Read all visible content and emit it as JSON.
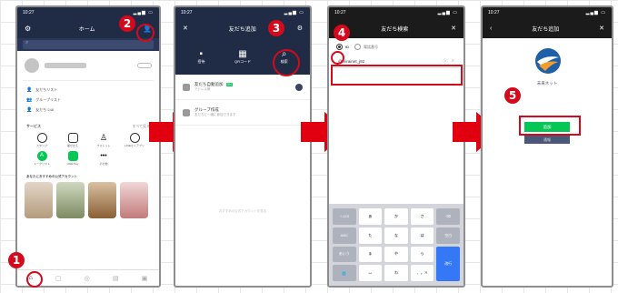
{
  "steps": [
    "1",
    "2",
    "3",
    "4",
    "5"
  ],
  "phone1": {
    "status_time": "10:27",
    "header_title": "ホーム",
    "menu": [
      "友だちリスト",
      "グループリスト",
      "友だち 248"
    ],
    "services_label": "サービス",
    "services_more": "すべて見る",
    "service_icons": [
      "スタンプ",
      "着せかえ",
      "ウォレット",
      "LINEミニアプリ",
      "トークリスト",
      "LINE Pay",
      "その他"
    ],
    "recommend_label": "あなたにおすすめの公式アカウント"
  },
  "phone2": {
    "status_time": "10:27",
    "header_title": "友だち追加",
    "tabs": [
      "招待",
      "QRコード",
      "検索"
    ],
    "list": [
      {
        "title": "友だち自動追加",
        "badge": "ON",
        "sub": "アドレス帳"
      },
      {
        "title": "グループ作成",
        "sub": "友だちと一緒に参加できます"
      }
    ],
    "footer_hint": "おすすめの公式アカウントを見る"
  },
  "phone3": {
    "status_time": "10:27",
    "header_title": "友だち検索",
    "radio_id": "ID",
    "radio_phone": "電話番号",
    "search_value": "@mirainet_j92",
    "keyboard_keys": [
      "☆123",
      "あ",
      "か",
      "さ",
      "⌫",
      "ABC",
      "た",
      "な",
      "は",
      "空白",
      "あいう",
      "ま",
      "や",
      "ら",
      "改行",
      "🌐",
      "^^",
      "わ",
      "、。?!"
    ]
  },
  "phone4": {
    "status_time": "10:27",
    "header_title": "友だち追加",
    "account_name": "未来ネット",
    "add_button": "追加",
    "report_button": "通報"
  },
  "colors": {
    "accent_red": "#d6091c",
    "header_navy": "#202b45",
    "line_green": "#06c755"
  }
}
